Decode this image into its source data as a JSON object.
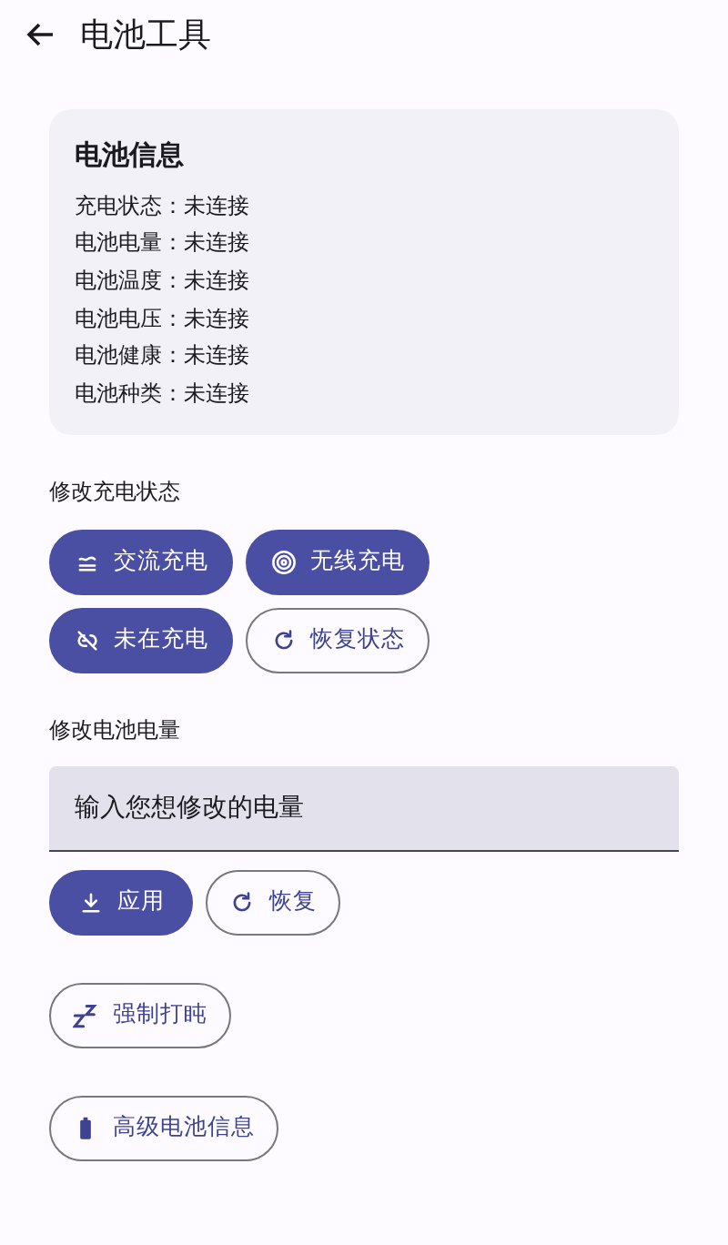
{
  "app_bar": {
    "title": "电池工具"
  },
  "info_card": {
    "title": "电池信息",
    "rows": [
      {
        "label": "充电状态：",
        "value": "未连接"
      },
      {
        "label": "电池电量：",
        "value": "未连接"
      },
      {
        "label": "电池温度：",
        "value": "未连接"
      },
      {
        "label": "电池电压：",
        "value": "未连接"
      },
      {
        "label": "电池健康：",
        "value": "未连接"
      },
      {
        "label": "电池种类：",
        "value": "未连接"
      }
    ]
  },
  "charge_section": {
    "label": "修改充电状态",
    "buttons": [
      {
        "label": "交流充电",
        "kind": "filled"
      },
      {
        "label": "无线充电",
        "kind": "filled"
      },
      {
        "label": "未在充电",
        "kind": "filled"
      },
      {
        "label": "恢复状态",
        "kind": "outlined"
      }
    ]
  },
  "level_section": {
    "label": "修改电池电量",
    "input": {
      "placeholder": "输入您想修改的电量"
    },
    "buttons": [
      {
        "label": "应用",
        "kind": "filled"
      },
      {
        "label": "恢复",
        "kind": "outlined"
      }
    ]
  },
  "extra_buttons": [
    {
      "label": "强制打盹",
      "kind": "outlined"
    },
    {
      "label": "高级电池信息",
      "kind": "outlined"
    }
  ]
}
